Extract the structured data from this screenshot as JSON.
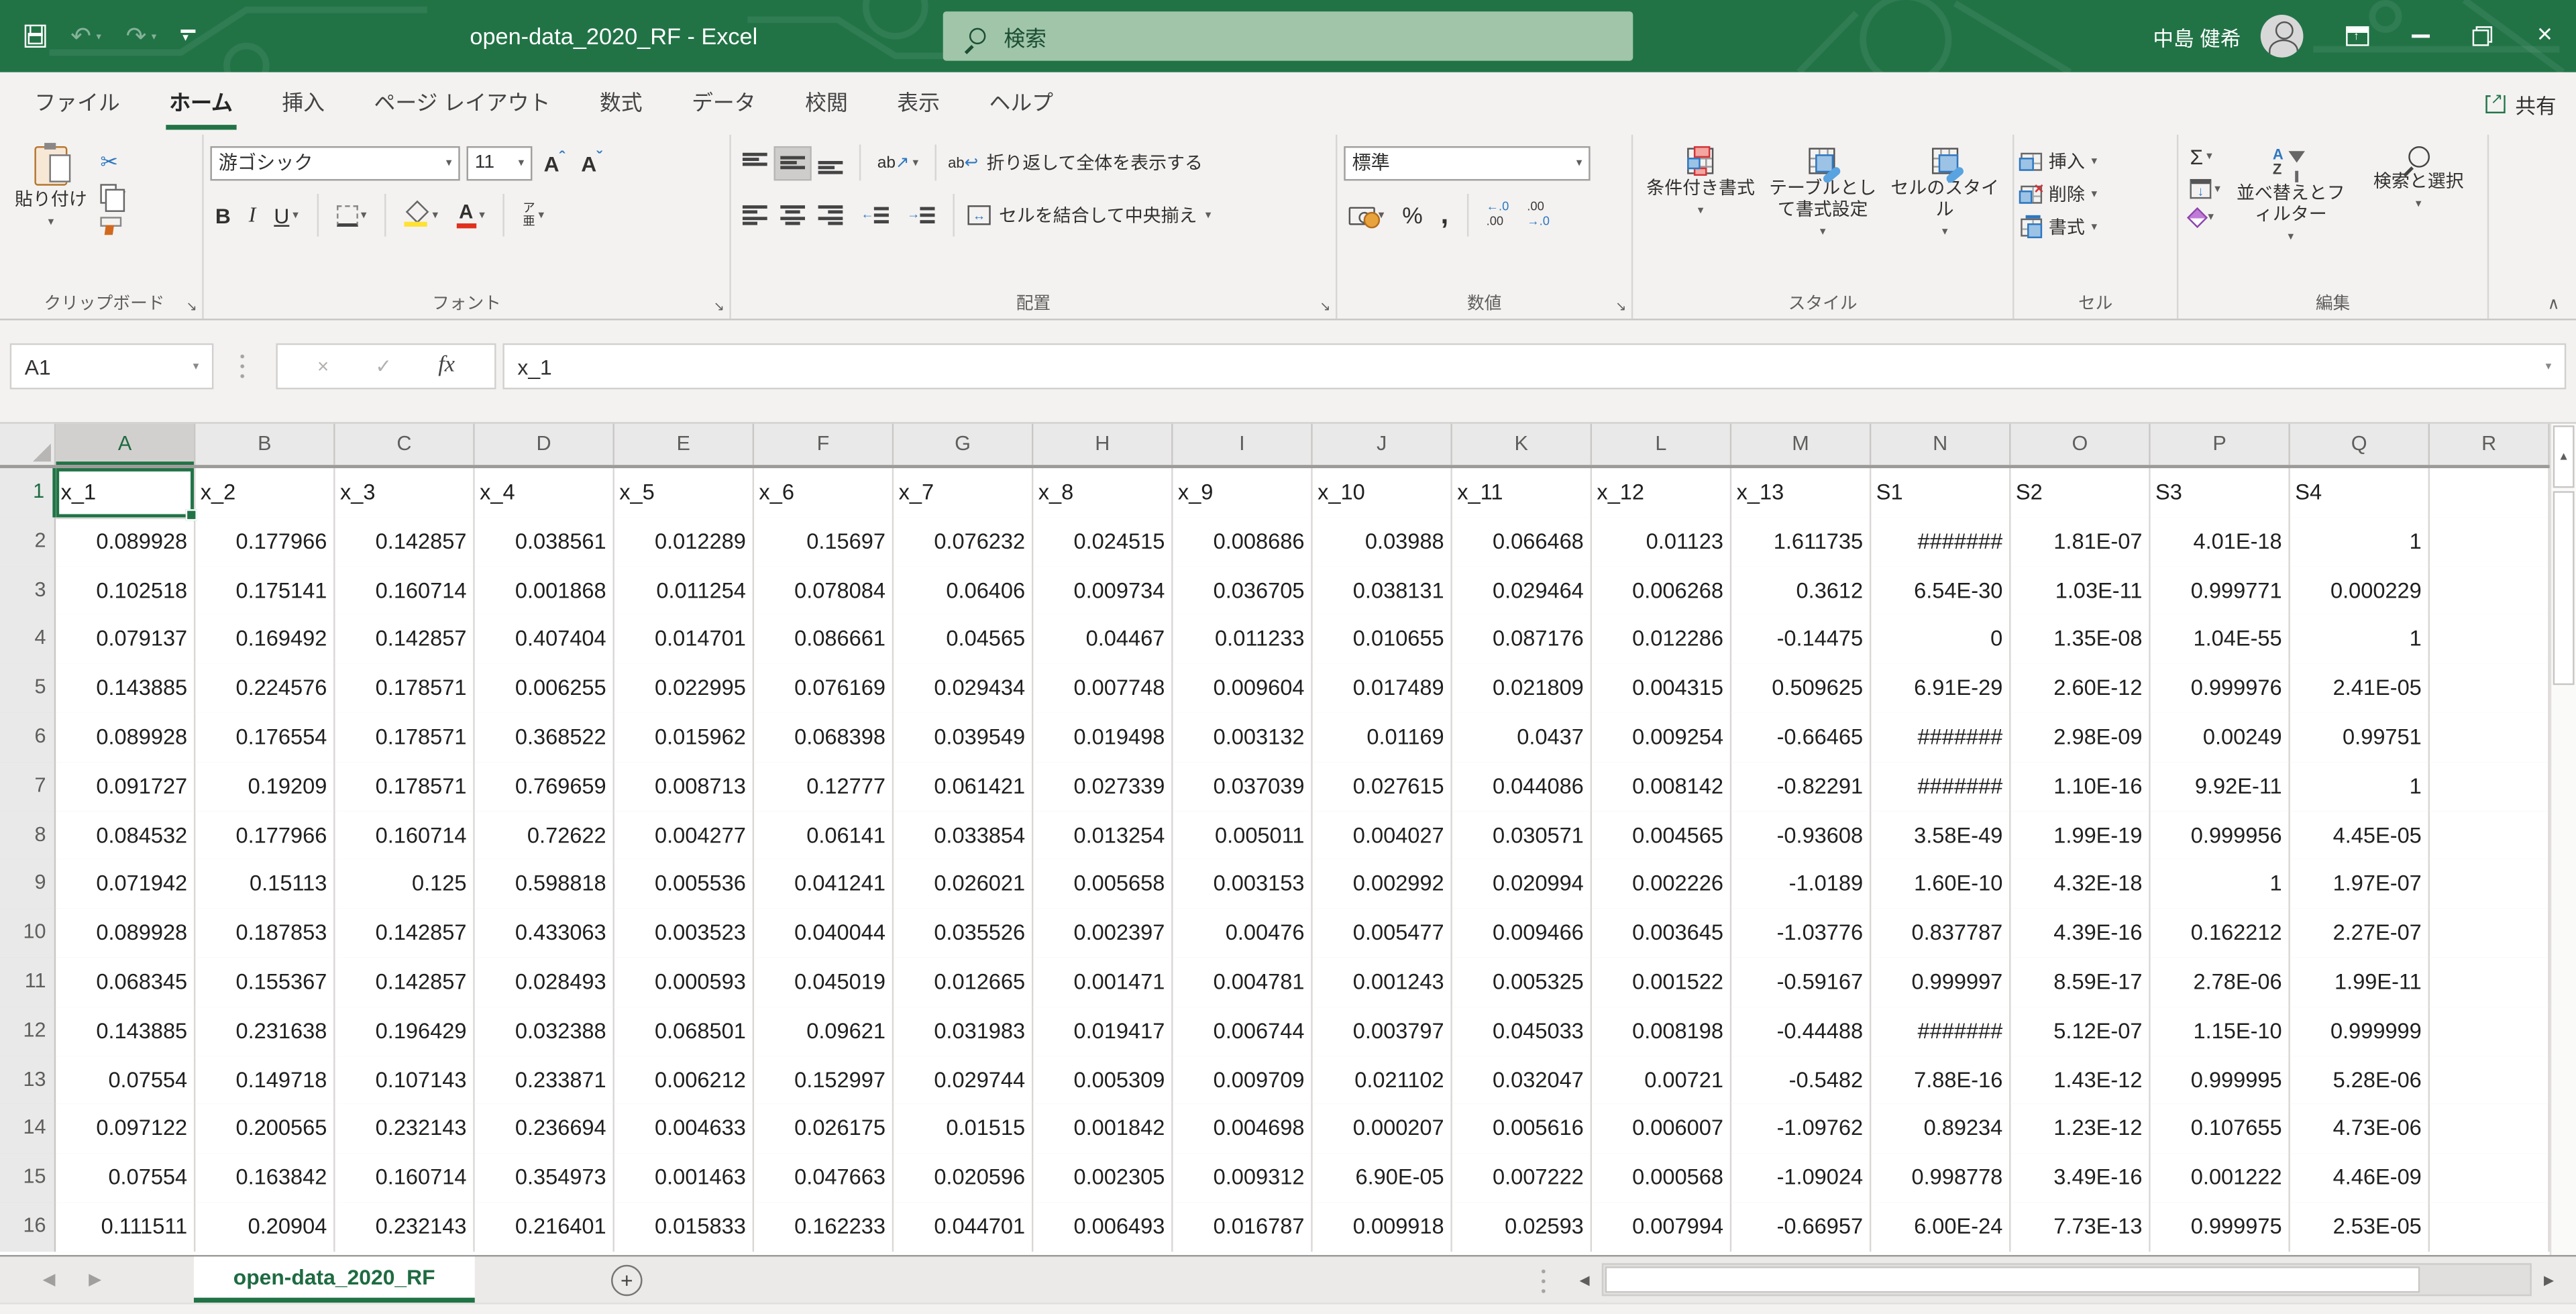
{
  "titlebar": {
    "title": "open-data_2020_RF  -  Excel",
    "search_placeholder": "検索",
    "user_name": "中島 健希"
  },
  "tabs": {
    "items": [
      "ファイル",
      "ホーム",
      "挿入",
      "ページ レイアウト",
      "数式",
      "データ",
      "校閲",
      "表示",
      "ヘルプ"
    ],
    "active_index": 1,
    "share_label": "共有"
  },
  "ribbon": {
    "clipboard": {
      "paste_label": "貼り付け",
      "group_label": "クリップボード"
    },
    "font": {
      "font_name": "游ゴシック",
      "font_size": "11",
      "bold": "B",
      "italic": "I",
      "underline": "U",
      "grow": "A",
      "shrink": "A",
      "font_color": "A",
      "phonetic_top": "ア",
      "phonetic_bottom": "亜",
      "group_label": "フォント"
    },
    "alignment": {
      "orientation_ab": "ab",
      "wrap_ab": "ab",
      "wrap_label": "折り返して全体を表示する",
      "merge_label": "セルを結合して中央揃え",
      "group_label": "配置"
    },
    "number": {
      "format": "標準",
      "percent": "%",
      "comma": ",",
      "group_label": "数値"
    },
    "styles": {
      "conditional_label": "条件付き書式",
      "table_label": "テーブルとして書式設定",
      "cellstyles_label": "セルのスタイル",
      "group_label": "スタイル"
    },
    "cells": {
      "insert_label": "挿入",
      "delete_label": "削除",
      "format_label": "書式",
      "group_label": "セル"
    },
    "editing": {
      "autosum": "Σ",
      "az_a": "A",
      "az_z": "Z",
      "sort_label": "並べ替えとフィルター",
      "find_label": "検索と選択",
      "group_label": "編集"
    }
  },
  "formula_bar": {
    "name_box": "A1",
    "fx_label": "fx",
    "content": "x_1"
  },
  "grid": {
    "columns": [
      "A",
      "B",
      "C",
      "D",
      "E",
      "F",
      "G",
      "H",
      "I",
      "J",
      "K",
      "L",
      "M",
      "N",
      "O",
      "P",
      "Q",
      "R"
    ],
    "selected_cell": "A1",
    "rows": [
      {
        "n": 1,
        "cells": [
          "x_1",
          "x_2",
          "x_3",
          "x_4",
          "x_5",
          "x_6",
          "x_7",
          "x_8",
          "x_9",
          "x_10",
          "x_11",
          "x_12",
          "x_13",
          "S1",
          "S2",
          "S3",
          "S4",
          ""
        ]
      },
      {
        "n": 2,
        "cells": [
          "0.089928",
          "0.177966",
          "0.142857",
          "0.038561",
          "0.012289",
          "0.15697",
          "0.076232",
          "0.024515",
          "0.008686",
          "0.03988",
          "0.066468",
          "0.01123",
          "1.611735",
          "#######",
          "1.81E-07",
          "4.01E-18",
          "1",
          ""
        ]
      },
      {
        "n": 3,
        "cells": [
          "0.102518",
          "0.175141",
          "0.160714",
          "0.001868",
          "0.011254",
          "0.078084",
          "0.06406",
          "0.009734",
          "0.036705",
          "0.038131",
          "0.029464",
          "0.006268",
          "0.3612",
          "6.54E-30",
          "1.03E-11",
          "0.999771",
          "0.000229",
          ""
        ]
      },
      {
        "n": 4,
        "cells": [
          "0.079137",
          "0.169492",
          "0.142857",
          "0.407404",
          "0.014701",
          "0.086661",
          "0.04565",
          "0.04467",
          "0.011233",
          "0.010655",
          "0.087176",
          "0.012286",
          "-0.14475",
          "0",
          "1.35E-08",
          "1.04E-55",
          "1",
          ""
        ]
      },
      {
        "n": 5,
        "cells": [
          "0.143885",
          "0.224576",
          "0.178571",
          "0.006255",
          "0.022995",
          "0.076169",
          "0.029434",
          "0.007748",
          "0.009604",
          "0.017489",
          "0.021809",
          "0.004315",
          "0.509625",
          "6.91E-29",
          "2.60E-12",
          "0.999976",
          "2.41E-05",
          ""
        ]
      },
      {
        "n": 6,
        "cells": [
          "0.089928",
          "0.176554",
          "0.178571",
          "0.368522",
          "0.015962",
          "0.068398",
          "0.039549",
          "0.019498",
          "0.003132",
          "0.01169",
          "0.0437",
          "0.009254",
          "-0.66465",
          "#######",
          "2.98E-09",
          "0.00249",
          "0.99751",
          ""
        ]
      },
      {
        "n": 7,
        "cells": [
          "0.091727",
          "0.19209",
          "0.178571",
          "0.769659",
          "0.008713",
          "0.12777",
          "0.061421",
          "0.027339",
          "0.037039",
          "0.027615",
          "0.044086",
          "0.008142",
          "-0.82291",
          "#######",
          "1.10E-16",
          "9.92E-11",
          "1",
          ""
        ]
      },
      {
        "n": 8,
        "cells": [
          "0.084532",
          "0.177966",
          "0.160714",
          "0.72622",
          "0.004277",
          "0.06141",
          "0.033854",
          "0.013254",
          "0.005011",
          "0.004027",
          "0.030571",
          "0.004565",
          "-0.93608",
          "3.58E-49",
          "1.99E-19",
          "0.999956",
          "4.45E-05",
          ""
        ]
      },
      {
        "n": 9,
        "cells": [
          "0.071942",
          "0.15113",
          "0.125",
          "0.598818",
          "0.005536",
          "0.041241",
          "0.026021",
          "0.005658",
          "0.003153",
          "0.002992",
          "0.020994",
          "0.002226",
          "-1.0189",
          "1.60E-10",
          "4.32E-18",
          "1",
          "1.97E-07",
          ""
        ]
      },
      {
        "n": 10,
        "cells": [
          "0.089928",
          "0.187853",
          "0.142857",
          "0.433063",
          "0.003523",
          "0.040044",
          "0.035526",
          "0.002397",
          "0.00476",
          "0.005477",
          "0.009466",
          "0.003645",
          "-1.03776",
          "0.837787",
          "4.39E-16",
          "0.162212",
          "2.27E-07",
          ""
        ]
      },
      {
        "n": 11,
        "cells": [
          "0.068345",
          "0.155367",
          "0.142857",
          "0.028493",
          "0.000593",
          "0.045019",
          "0.012665",
          "0.001471",
          "0.004781",
          "0.001243",
          "0.005325",
          "0.001522",
          "-0.59167",
          "0.999997",
          "8.59E-17",
          "2.78E-06",
          "1.99E-11",
          ""
        ]
      },
      {
        "n": 12,
        "cells": [
          "0.143885",
          "0.231638",
          "0.196429",
          "0.032388",
          "0.068501",
          "0.09621",
          "0.031983",
          "0.019417",
          "0.006744",
          "0.003797",
          "0.045033",
          "0.008198",
          "-0.44488",
          "#######",
          "5.12E-07",
          "1.15E-10",
          "0.999999",
          ""
        ]
      },
      {
        "n": 13,
        "cells": [
          "0.07554",
          "0.149718",
          "0.107143",
          "0.233871",
          "0.006212",
          "0.152997",
          "0.029744",
          "0.005309",
          "0.009709",
          "0.021102",
          "0.032047",
          "0.00721",
          "-0.5482",
          "7.88E-16",
          "1.43E-12",
          "0.999995",
          "5.28E-06",
          ""
        ]
      },
      {
        "n": 14,
        "cells": [
          "0.097122",
          "0.200565",
          "0.232143",
          "0.236694",
          "0.004633",
          "0.026175",
          "0.01515",
          "0.001842",
          "0.004698",
          "0.000207",
          "0.005616",
          "0.006007",
          "-1.09762",
          "0.89234",
          "1.23E-12",
          "0.107655",
          "4.73E-06",
          ""
        ]
      },
      {
        "n": 15,
        "cells": [
          "0.07554",
          "0.163842",
          "0.160714",
          "0.354973",
          "0.001463",
          "0.047663",
          "0.020596",
          "0.002305",
          "0.009312",
          "6.90E-05",
          "0.007222",
          "0.000568",
          "-1.09024",
          "0.998778",
          "3.49E-16",
          "0.001222",
          "4.46E-09",
          ""
        ]
      },
      {
        "n": 16,
        "cells": [
          "0.111511",
          "0.20904",
          "0.232143",
          "0.216401",
          "0.015833",
          "0.162233",
          "0.044701",
          "0.006493",
          "0.016787",
          "0.009918",
          "0.02593",
          "0.007994",
          "-0.66957",
          "6.00E-24",
          "7.73E-13",
          "0.999975",
          "2.53E-05",
          ""
        ]
      }
    ]
  },
  "sheetbar": {
    "sheet_name": "open-data_2020_RF"
  },
  "icons": {
    "undo": "↶",
    "redo": "↷",
    "scissors": "✂",
    "cancel": "×",
    "check": "✓",
    "collapse_ribbon": "∧"
  },
  "colors": {
    "accent_green": "#217346",
    "titlebar_green": "#217346",
    "search_box_bg": "#a0c5a9",
    "selected_cell_border": "#217346",
    "fill_color_swatch": "#ffe234",
    "font_color_swatch": "#e0301e"
  }
}
